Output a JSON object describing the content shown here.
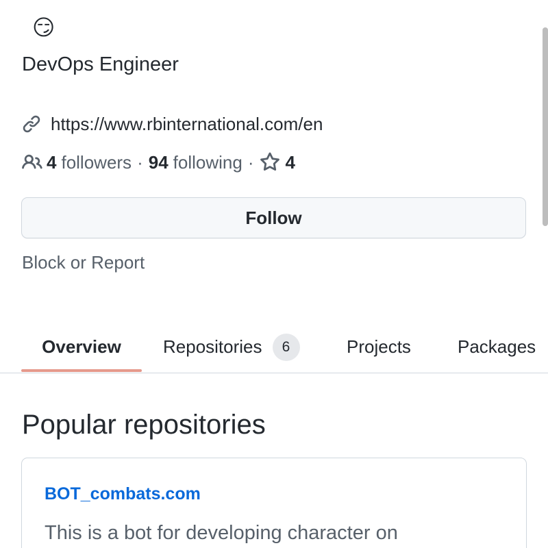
{
  "profile": {
    "status_emoji": "😏",
    "bio": "DevOps Engineer",
    "website": "https://www.rbinternational.com/en",
    "followers_count": "4",
    "followers_label": "followers",
    "separator": "·",
    "following_count": "94",
    "following_label": "following",
    "stars_count": "4"
  },
  "actions": {
    "follow_label": "Follow",
    "block_label": "Block or Report"
  },
  "tabs": [
    {
      "label": "Overview",
      "selected": true
    },
    {
      "label": "Repositories",
      "count": "6"
    },
    {
      "label": "Projects"
    },
    {
      "label": "Packages"
    }
  ],
  "popular": {
    "heading": "Popular repositories",
    "repos": [
      {
        "name": "BOT_combats.com",
        "description": "This is a bot for developing character on"
      }
    ]
  },
  "colors": {
    "link": "#0969da",
    "tab_underline": "#e5998c",
    "muted_text": "#57606a",
    "border": "#d0d7de"
  },
  "icons": {
    "link": "link-icon",
    "people": "people-icon",
    "star": "star-icon"
  }
}
